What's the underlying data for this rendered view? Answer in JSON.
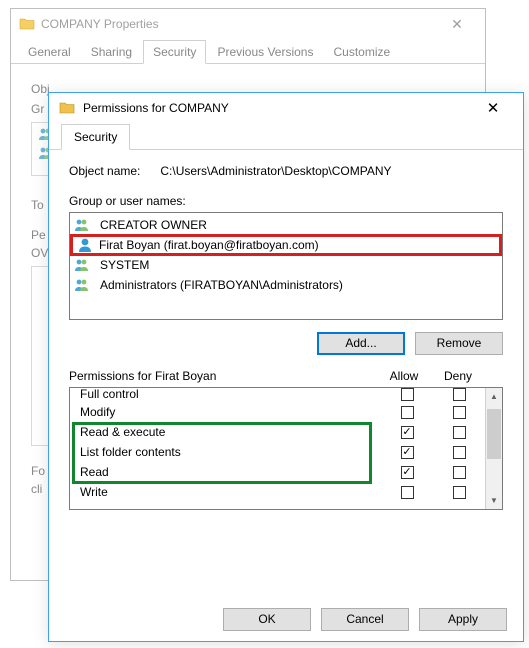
{
  "back": {
    "title": "COMPANY Properties",
    "tabs": [
      "General",
      "Sharing",
      "Security",
      "Previous Versions",
      "Customize"
    ],
    "active_tab": "Security",
    "obj_label_short": "Obj",
    "group_label_short": "Gr",
    "to_label": "To",
    "perm_line1": "Pe",
    "perm_line2": "OV",
    "for_line1": "Fo",
    "for_line2": "cli"
  },
  "front": {
    "title": "Permissions for COMPANY",
    "tab": "Security",
    "object_label": "Object name:",
    "object_value": "C:\\Users\\Administrator\\Desktop\\COMPANY",
    "gu_label": "Group or user names:",
    "groups": [
      {
        "name": "CREATOR OWNER",
        "type": "group"
      },
      {
        "name": "Firat Boyan (firat.boyan@firatboyan.com)",
        "type": "user",
        "highlight": "red"
      },
      {
        "name": "SYSTEM",
        "type": "group"
      },
      {
        "name": "Administrators (FIRATBOYAN\\Administrators)",
        "type": "group"
      }
    ],
    "add_btn": "Add...",
    "remove_btn": "Remove",
    "perm_title": "Permissions for Firat Boyan",
    "allow_head": "Allow",
    "deny_head": "Deny",
    "permissions": [
      {
        "label": "Full control",
        "allow": false,
        "deny": false
      },
      {
        "label": "Modify",
        "allow": false,
        "deny": false
      },
      {
        "label": "Read & execute",
        "allow": true,
        "deny": false
      },
      {
        "label": "List folder contents",
        "allow": true,
        "deny": false
      },
      {
        "label": "Read",
        "allow": true,
        "deny": false
      },
      {
        "label": "Write",
        "allow": false,
        "deny": false
      }
    ],
    "ok": "OK",
    "cancel": "Cancel",
    "apply": "Apply"
  }
}
